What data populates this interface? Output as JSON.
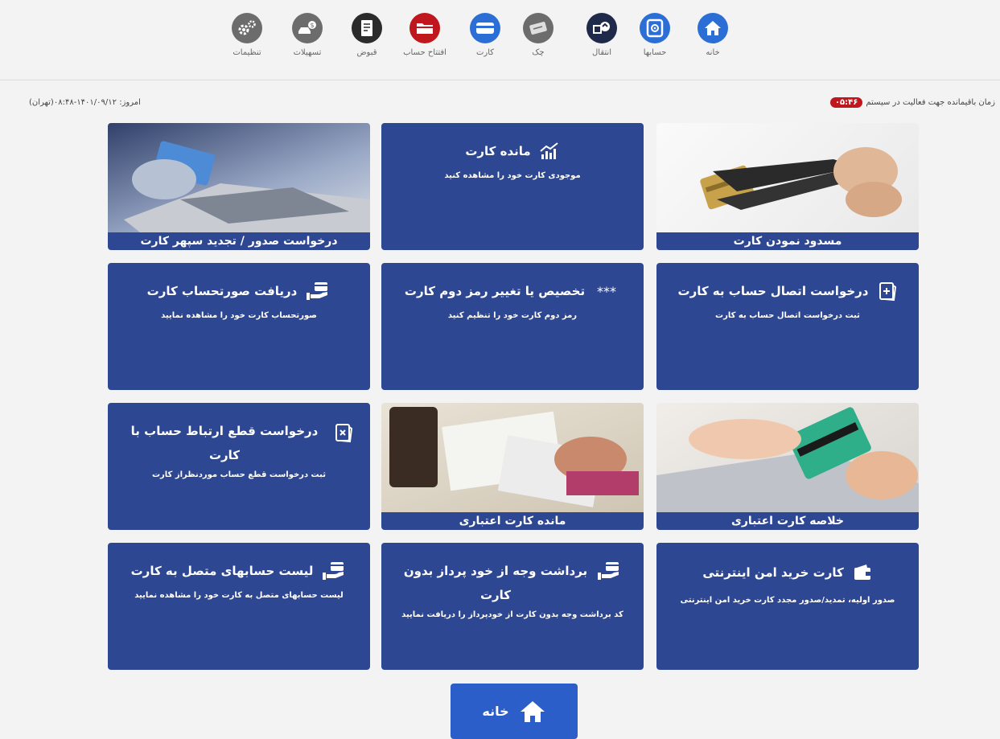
{
  "nav": {
    "items": [
      {
        "label": "خانه",
        "icon": "home-icon",
        "color": "#2b6fd6"
      },
      {
        "label": "حسابها",
        "icon": "safe-icon",
        "color": "#2b6fd6"
      },
      {
        "label": "انتقال",
        "icon": "transfer-icon",
        "color": "#1f2a4a"
      },
      {
        "label": "چک",
        "icon": "check-icon",
        "color": "#6c6c6c"
      },
      {
        "label": "کارت",
        "icon": "card-icon",
        "color": "#2b6fd6"
      },
      {
        "label": "افتتاح حساب",
        "icon": "folder-icon",
        "color": "#c0161e"
      },
      {
        "label": "قبوض",
        "icon": "bill-icon",
        "color": "#2b2b2b"
      },
      {
        "label": "تسهیلات",
        "icon": "car-loan-icon",
        "color": "#6c6c6c"
      },
      {
        "label": "تنظیمات",
        "icon": "gear-icon",
        "color": "#6c6c6c"
      }
    ]
  },
  "session": {
    "label": "زمان باقیمانده جهت فعالیت در سیستم",
    "timer": "۰۵:۴۶"
  },
  "today": {
    "text": "امروز: ۱۴۰۱/۰۹/۱۲-۰۸:۴۸(تهران)"
  },
  "tiles": {
    "block_card": {
      "caption": "مسدود نمودن کارت"
    },
    "card_balance": {
      "title": "مانده کارت",
      "desc": "موجودی کارت خود را مشاهده کنید"
    },
    "sepehr_issue": {
      "caption": "درخواست صدور / تجدید سپهر کارت"
    },
    "link_account": {
      "title": "درخواست اتصال حساب به کارت",
      "desc": "ثبت درخواست اتصال حساب به کارت"
    },
    "second_pin": {
      "title": "تخصیص یا تغییر رمز دوم کارت",
      "desc": "رمز دوم کارت خود را تنظیم کنید"
    },
    "statement": {
      "title": "دریافت صورتحساب کارت",
      "desc": "صورتحساب کارت خود را مشاهده نمایید"
    },
    "credit_summary": {
      "caption": "خلاصه کارت اعتباری"
    },
    "credit_balance": {
      "caption": "مانده کارت اعتباری"
    },
    "unlink_account": {
      "title": "درخواست قطع ارتباط حساب با کارت",
      "desc": "ثبت درخواست قطع حساب موردنظراز کارت"
    },
    "internet_card": {
      "title": "کارت خرید امن اینترنتی",
      "desc": "صدور اولیه، تمدید/صدور مجدد کارت خرید امن اینترنتی"
    },
    "cardless_withdraw": {
      "title": "برداشت وجه از خود پرداز بدون کارت",
      "desc": "کد برداشت وجه بدون کارت از خودپرداز را دریافت نمایید"
    },
    "linked_accounts": {
      "title": "لیست حسابهای متصل به کارت",
      "desc": "لیست حسابهای متصل به کارت خود را مشاهده نمایید"
    }
  },
  "home_button": {
    "label": "خانه"
  },
  "colors": {
    "tile": "#2e4792",
    "accent": "#2b5ec8",
    "badge": "#c0161e"
  }
}
